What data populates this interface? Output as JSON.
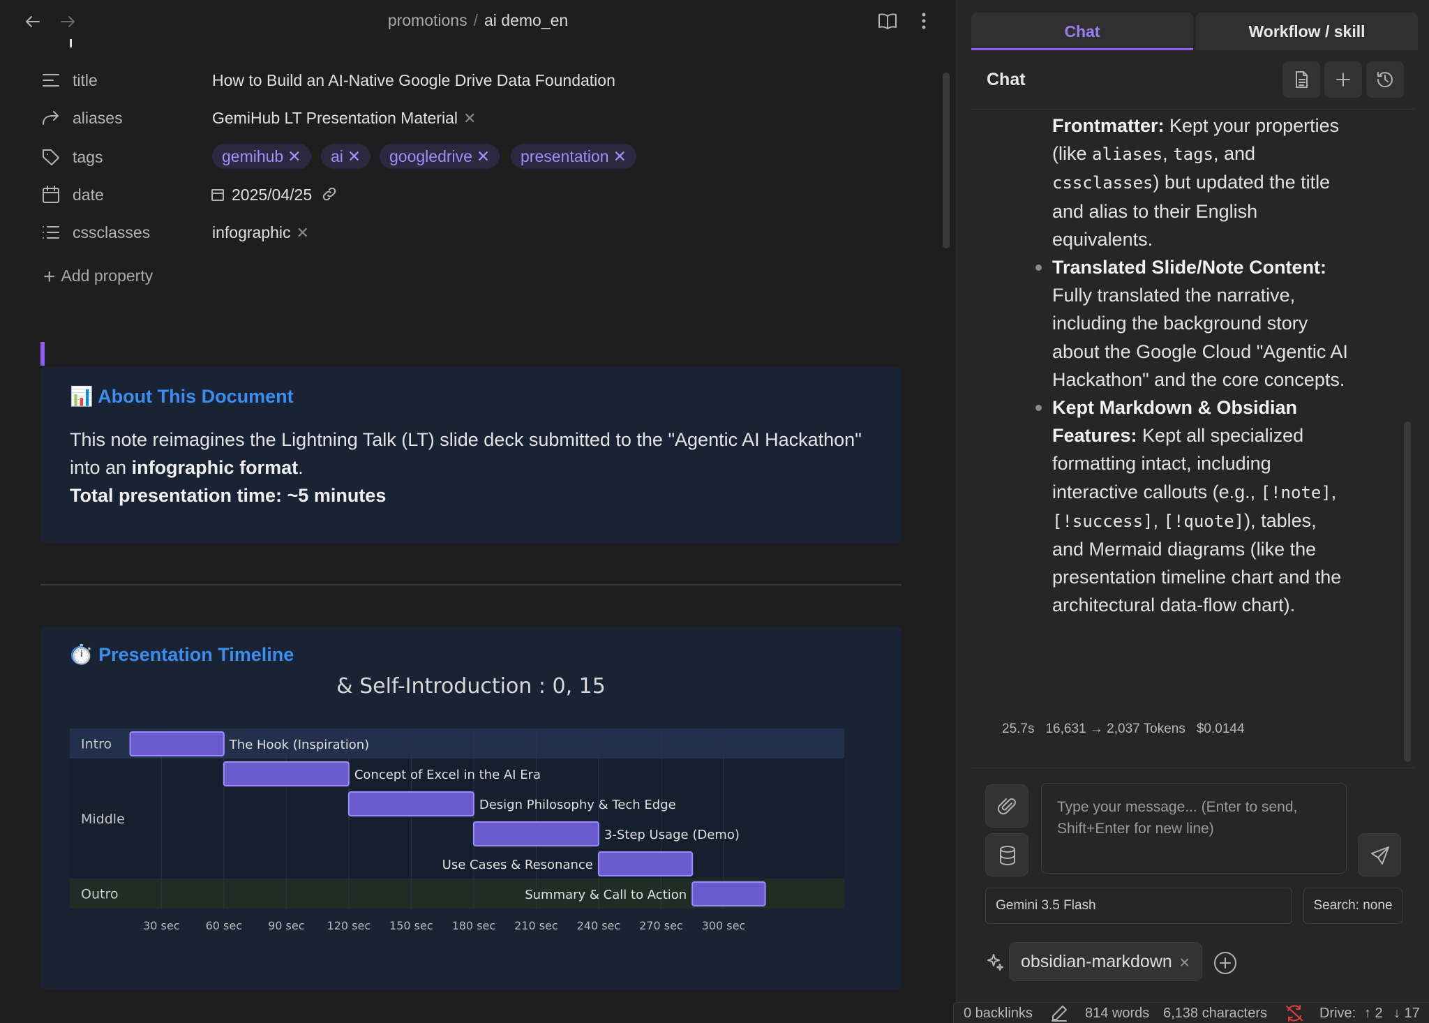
{
  "breadcrumb": {
    "folder": "promotions",
    "separator": "/",
    "file": "ai demo_en"
  },
  "properties": {
    "title": {
      "key": "title",
      "value": "How to Build an AI-Native Google Drive Data Foundation"
    },
    "aliases": {
      "key": "aliases",
      "value": "GemiHub LT Presentation Material"
    },
    "tags": {
      "key": "tags",
      "values": [
        "gemihub",
        "ai",
        "googledrive",
        "presentation"
      ]
    },
    "date": {
      "key": "date",
      "value": "2025/04/25"
    },
    "cssclasses": {
      "key": "cssclasses",
      "value": "infographic"
    },
    "add_label": "Add property"
  },
  "about": {
    "emoji": "📊",
    "title": "About This Document",
    "line1": "This note reimagines the Lightning Talk (LT) slide deck submitted to the \"Agentic AI Hackathon\"",
    "line2_pre": "into an ",
    "line2_bold": "infographic format",
    "line2_post": ".",
    "line3": "Total presentation time: ~5 minutes"
  },
  "timeline": {
    "emoji": "⏱️",
    "title": "Presentation Timeline"
  },
  "chart_data": {
    "type": "gantt",
    "title": "& Self-Introduction : 0, 15",
    "sections": [
      {
        "name": "Intro",
        "tasks": [
          {
            "label": "The Hook (Inspiration)",
            "start": 15,
            "end": 60
          }
        ]
      },
      {
        "name": "Middle",
        "tasks": [
          {
            "label": "Concept of Excel in the AI Era",
            "start": 60,
            "end": 120
          },
          {
            "label": "Design Philosophy & Tech Edge",
            "start": 120,
            "end": 180
          },
          {
            "label": "3-Step Usage (Demo)",
            "start": 180,
            "end": 240
          },
          {
            "label": "Use Cases & Resonance",
            "start": 240,
            "end": 285
          }
        ]
      },
      {
        "name": "Outro",
        "tasks": [
          {
            "label": "Summary & Call to Action",
            "start": 285,
            "end": 320
          }
        ]
      }
    ],
    "x_ticks": [
      "30 sec",
      "60 sec",
      "90 sec",
      "120 sec",
      "150 sec",
      "180 sec",
      "210 sec",
      "240 sec",
      "270 sec",
      "300 sec"
    ],
    "x_tick_values": [
      30,
      60,
      90,
      120,
      150,
      180,
      210,
      240,
      270,
      300
    ],
    "xlim": [
      -14,
      358
    ],
    "bar_color": "#6a5acd",
    "bar_stroke": "#9b8cff"
  },
  "right": {
    "tabs": {
      "chat": "Chat",
      "workflow": "Workflow / skill"
    },
    "header_title": "Chat",
    "message": {
      "p1_bold": "Frontmatter:",
      "p1_a": " Kept your properties (like ",
      "p1_code1": "aliases",
      "p1_b": ", ",
      "p1_code2": "tags",
      "p1_c": ", and ",
      "p1_code3": "cssclasses",
      "p1_d": ") but updated the title and alias to their English equivalents.",
      "p2_bold": "Translated Slide/Note Content:",
      "p2_text": " Fully translated the narrative, including the background story about the Google Cloud \"Agentic AI Hackathon\" and the core concepts.",
      "p3_bold": "Kept Markdown & Obsidian Features:",
      "p3_a": " Kept all specialized formatting intact, including interactive callouts (e.g., ",
      "p3_code1": "[!note]",
      "p3_b": ", ",
      "p3_code2": "[!success]",
      "p3_c": ", ",
      "p3_code3": "[!quote]",
      "p3_d": "), tables, and Mermaid diagrams (like the presentation timeline chart and the architectural data-flow chart)."
    },
    "meta": {
      "time": "25.7s",
      "tokens": "16,631 → 2,037 Tokens",
      "cost": "$0.0144"
    },
    "input_placeholder": "Type your message... (Enter to send, Shift+Enter for new line)",
    "model": "Gemini 3.5 Flash",
    "search": "Search: none",
    "skill": "obsidian-markdown"
  },
  "status": {
    "backlinks": "0 backlinks",
    "words": "814 words",
    "chars": "6,138 characters",
    "drive_label": "Drive:",
    "up": "↑ 2",
    "down": "↓ 17"
  },
  "colors": {
    "accent": "#8b5cf6",
    "link_blue": "#3b8df0",
    "tag_text": "#a88bfa",
    "sync_error": "#e03e3e"
  }
}
